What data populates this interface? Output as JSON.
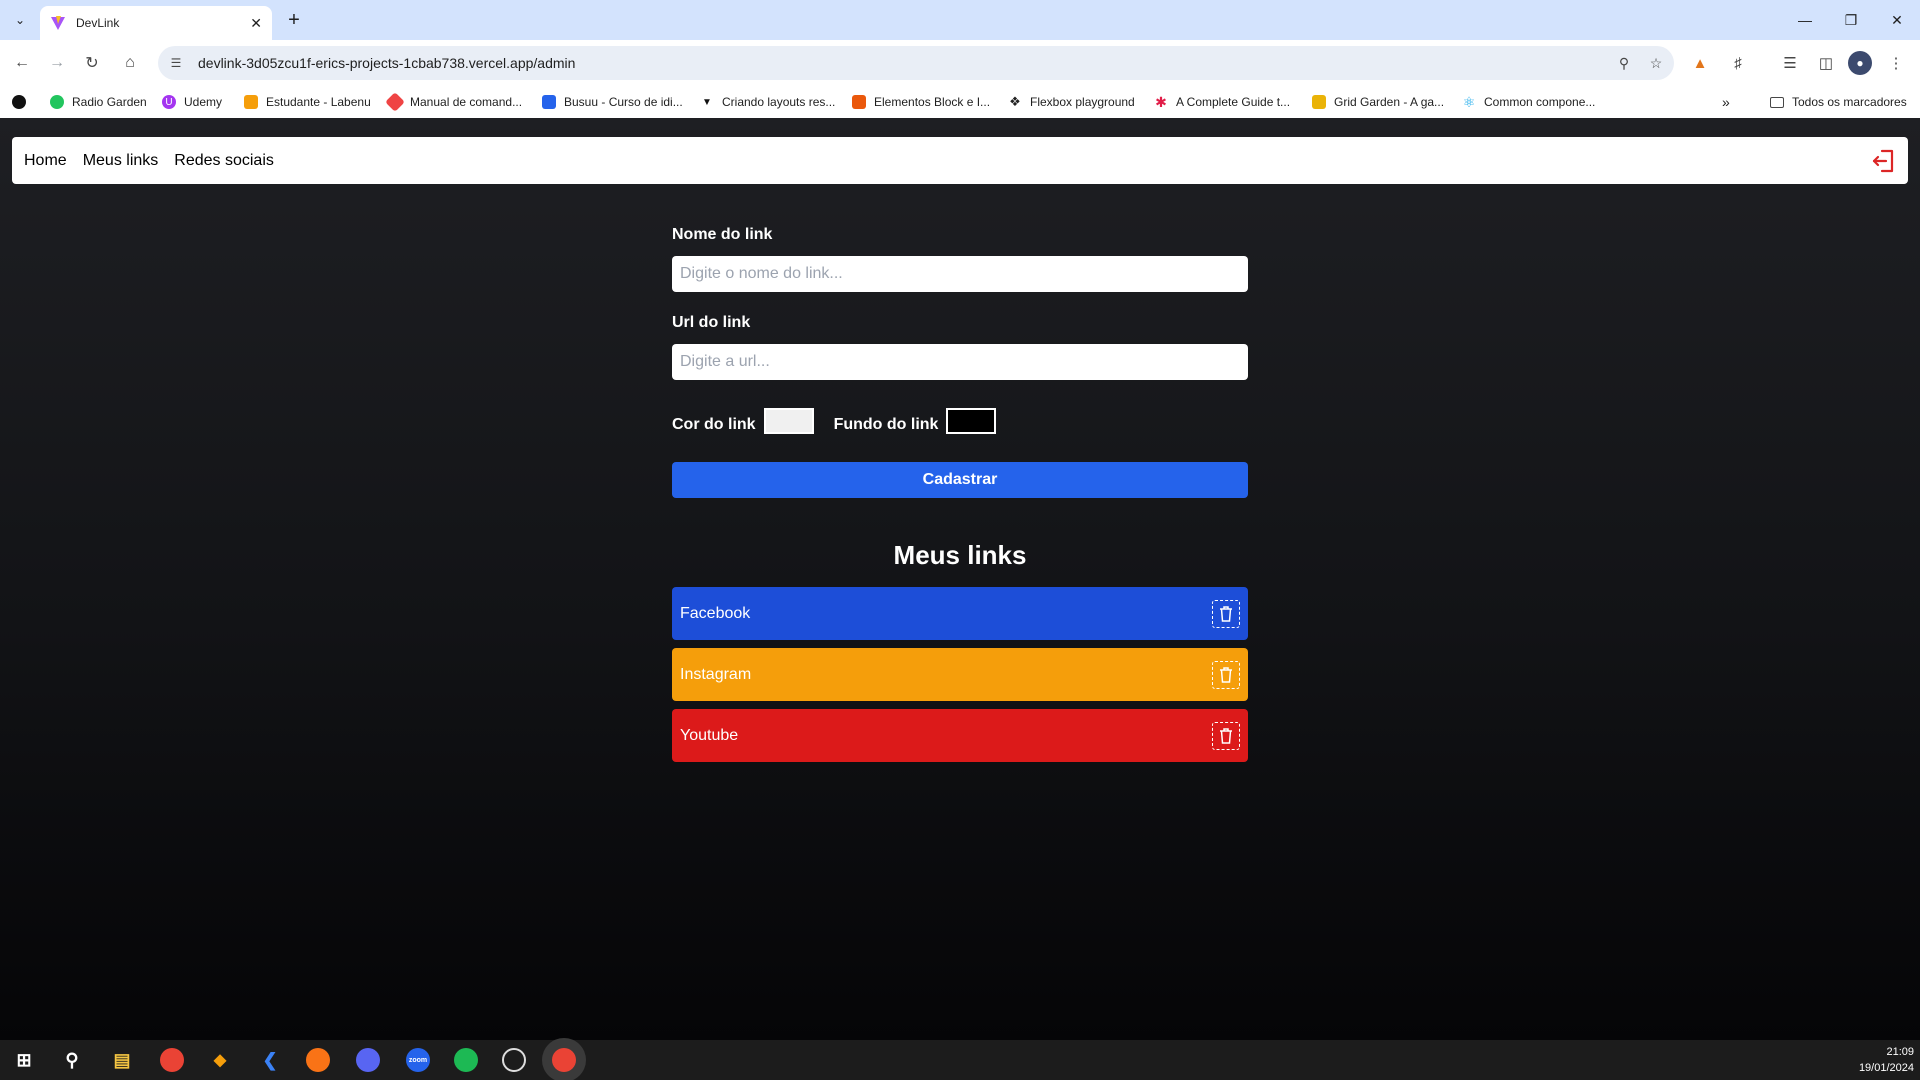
{
  "browser": {
    "tab_title": "DevLink",
    "url": "devlink-3d05zcu1f-erics-projects-1cbab738.vercel.app/admin",
    "bookmarks": [
      {
        "label": "Radio Garden",
        "color": "#22c55e"
      },
      {
        "label": "Udemy",
        "color": "#a435f0"
      },
      {
        "label": "Estudante - Labenu",
        "color": "#f59e0b"
      },
      {
        "label": "Manual de comand...",
        "color": "#ef4444"
      },
      {
        "label": "Busuu - Curso de idi...",
        "color": "#2563eb"
      },
      {
        "label": "Criando layouts res...",
        "color": "#111111"
      },
      {
        "label": "Elementos Block e I...",
        "color": "#ea580c"
      },
      {
        "label": "Flexbox playground",
        "color": "#222222"
      },
      {
        "label": "A Complete Guide t...",
        "color": "#e11d48"
      },
      {
        "label": "Grid Garden - A ga...",
        "color": "#eab308"
      },
      {
        "label": "Common compone...",
        "color": "#0ea5e9"
      }
    ],
    "all_bookmarks": "Todos os marcadores"
  },
  "header": {
    "nav": [
      "Home",
      "Meus links",
      "Redes sociais"
    ],
    "logout_color": "#dc2626"
  },
  "form": {
    "name_label": "Nome do link",
    "name_placeholder": "Digite o nome do link...",
    "url_label": "Url do link",
    "url_placeholder": "Digite a url...",
    "color_label": "Cor do link",
    "color_value": "#f0f0f0",
    "bg_label": "Fundo do link",
    "bg_value": "#000000",
    "submit": "Cadastrar"
  },
  "links_section": {
    "title": "Meus links",
    "items": [
      {
        "name": "Facebook",
        "bg": "#1d4ed8",
        "color": "#ffffff"
      },
      {
        "name": "Instagram",
        "bg": "#f59e0b",
        "color": "#ffffff"
      },
      {
        "name": "Youtube",
        "bg": "#dc1a1a",
        "color": "#ffffff"
      }
    ]
  },
  "taskbar": {
    "time": "21:09",
    "date": "19/01/2024"
  }
}
